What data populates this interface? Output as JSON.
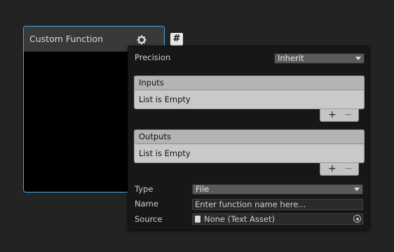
{
  "node": {
    "title": "Custom Function",
    "tab_badge": "#"
  },
  "panel": {
    "precision": {
      "label": "Precision",
      "value": "Inherit"
    },
    "inputs": {
      "header": "Inputs",
      "empty_text": "List is Empty",
      "add": "+",
      "remove": "−"
    },
    "outputs": {
      "header": "Outputs",
      "empty_text": "List is Empty",
      "add": "+",
      "remove": "−"
    },
    "type": {
      "label": "Type",
      "value": "File"
    },
    "name": {
      "label": "Name",
      "placeholder": "Enter function name here..."
    },
    "source": {
      "label": "Source",
      "value": "None (Text Asset)"
    }
  },
  "colors": {
    "accent": "#46a9e0",
    "background": "#232323",
    "panel": "#171717"
  }
}
